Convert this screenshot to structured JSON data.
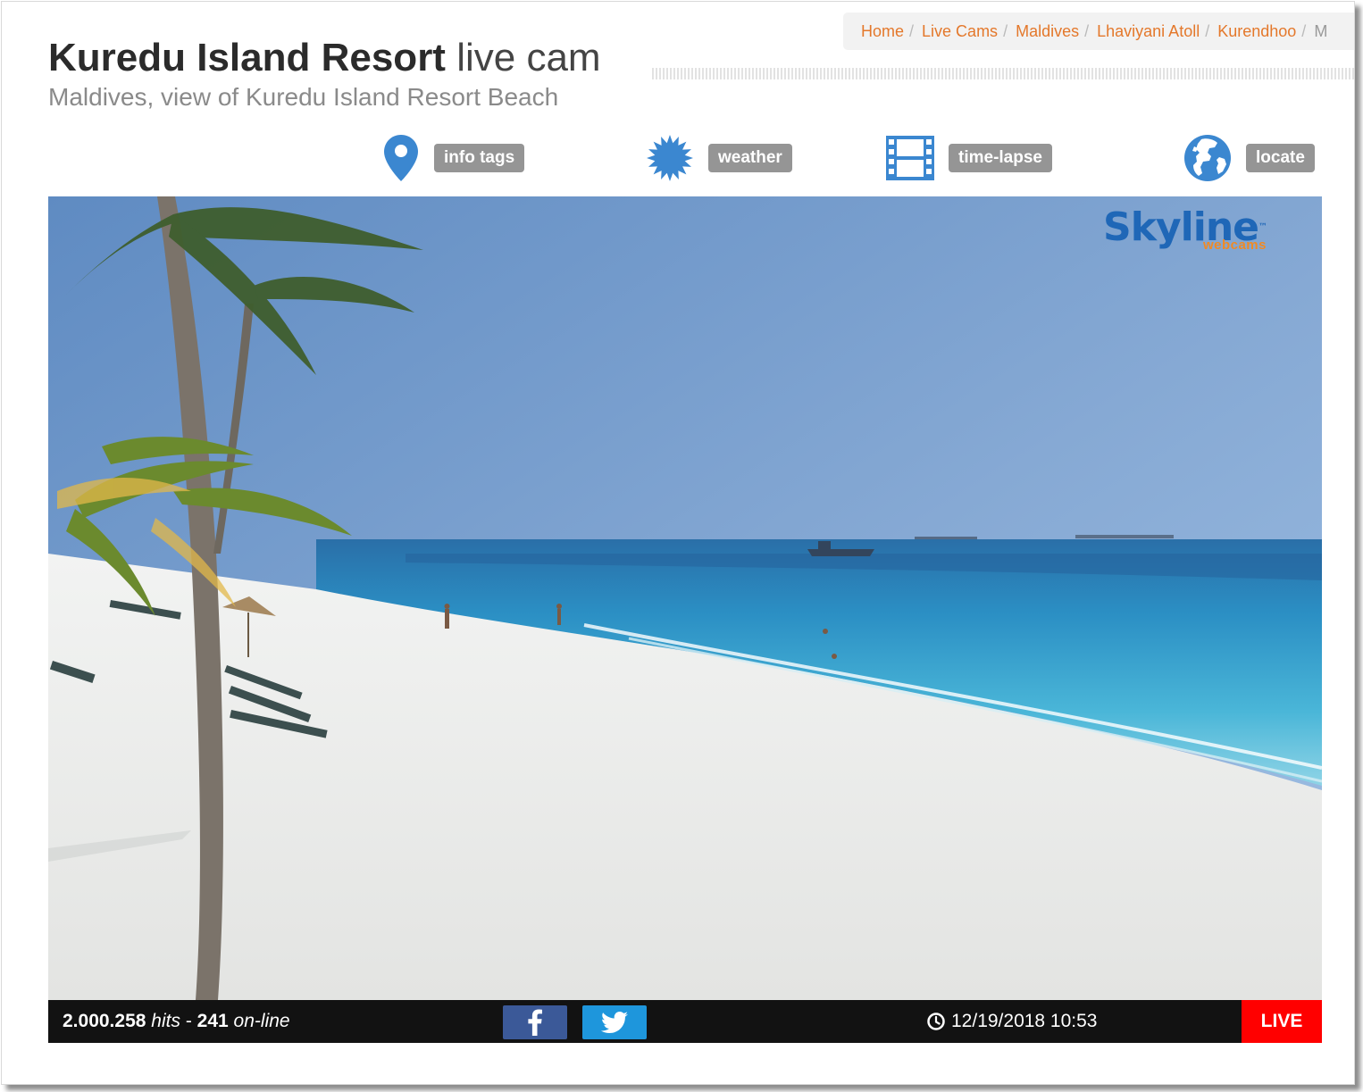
{
  "header": {
    "title_bold": "Kuredu Island Resort",
    "title_light": "live cam",
    "subtitle": "Maldives, view of Kuredu Island Resort Beach"
  },
  "breadcrumb": {
    "items": [
      "Home",
      "Live Cams",
      "Maldives",
      "Lhaviyani Atoll",
      "Kurendhoo",
      "M"
    ]
  },
  "toolbar": [
    {
      "label": "info tags",
      "icon": "map-pin-icon"
    },
    {
      "label": "weather",
      "icon": "sun-burst-icon"
    },
    {
      "label": "time-lapse",
      "icon": "film-strip-icon"
    },
    {
      "label": "locate",
      "icon": "globe-icon"
    }
  ],
  "player": {
    "logo_main": "Skyline",
    "logo_tm": "™",
    "logo_sub": "webcams",
    "hits": "2.000.258",
    "hits_label": "hits",
    "separator": "-",
    "online": "241",
    "online_label": "on-line",
    "datetime": "12/19/2018 10:53",
    "live_label": "LIVE",
    "facebook_icon": "facebook-icon",
    "twitter_icon": "twitter-icon"
  },
  "colors": {
    "link": "#e4782b",
    "icon_blue": "#3b87d0",
    "tag_bg": "#959595",
    "bar_bg": "#121212",
    "facebook": "#3b5998",
    "twitter": "#1e96dc",
    "live": "#ff0000"
  }
}
